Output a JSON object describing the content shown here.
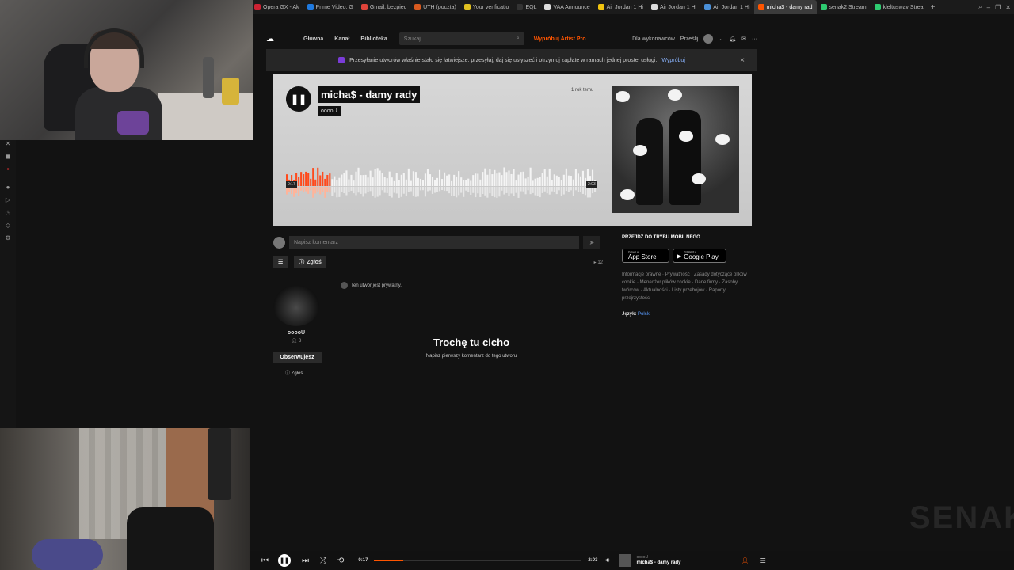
{
  "browser": {
    "tabs": [
      {
        "label": "Opera GX - Ak",
        "color": "#cc2233"
      },
      {
        "label": "Prime Video: G",
        "color": "#1f7ae0"
      },
      {
        "label": "Gmail: bezpiec",
        "color": "#e0443a"
      },
      {
        "label": "UTH (poczta)",
        "color": "#d85a1f"
      },
      {
        "label": "Your verificatio",
        "color": "#e0c020"
      },
      {
        "label": "EQL",
        "color": "#333333"
      },
      {
        "label": "VAA Announce",
        "color": "#dddddd"
      },
      {
        "label": "Air Jordan 1 Hi",
        "color": "#f1c40f"
      },
      {
        "label": "Air Jordan 1 Hi",
        "color": "#dddddd"
      },
      {
        "label": "Air Jordan 1 Hi",
        "color": "#4a90d9"
      },
      {
        "label": "micha$ - damy rad",
        "color": "#ff5500",
        "active": true
      },
      {
        "label": "senak2 Stream",
        "color": "#2ecc71"
      },
      {
        "label": "kleltuswav Strea",
        "color": "#2ecc71"
      }
    ],
    "add_tab_icon": "plus-icon",
    "toolbar_icons": [
      "search-icon",
      "minimize-icon",
      "restore-icon",
      "close-icon"
    ]
  },
  "sc_header": {
    "nav": [
      "Główna",
      "Kanał",
      "Biblioteka"
    ],
    "search_placeholder": "Szukaj",
    "pro_link": "Wypróbuj Artist Pro",
    "for_artists": "Dla wykonawców",
    "upload": "Prześlij"
  },
  "banner": {
    "text": "Przesyłanie utworów właśnie stało się łatwiejsze: przesyłaj, daj się usłyszeć i otrzymuj zapłatę w ramach jednej prostej usługi.",
    "link": "Wypróbuj",
    "close": "×"
  },
  "track": {
    "title": "micha$ - damy rady",
    "artist": "ooooU",
    "age": "1 rok temu",
    "time_start": "0:17",
    "time_end": "2:03",
    "progress": 0.14
  },
  "comment": {
    "placeholder": "Napisz komentarz",
    "report_label": "Zgłoś",
    "plays": "12"
  },
  "artist": {
    "name": "ooooU",
    "followers": "3",
    "follow_label": "Obserwujesz",
    "report_label": "Zgłoś"
  },
  "private_note": "Ten utwór jest prywatny.",
  "empty_comments": {
    "title": "Trochę tu cicho",
    "subtitle": "Napisz pierwszy komentarz do tego utworu"
  },
  "sidebar": {
    "mobile_heading": "PRZEJDŹ DO TRYBU MOBILNEGO",
    "app_store_small": "Pobierz w",
    "app_store": "App Store",
    "google_small": "POBIERZ Z",
    "google_play": "Google Play",
    "links": "Informacje prawne · Prywatność · Zasady dotyczące plików cookie · Menedżer plików cookie · Dane firmy · Zasoby twórców · Aktualności · Listy przebojów · Raporty przejrzystości",
    "language_label": "Język:",
    "language_value": "Polski"
  },
  "watermark": "SENAK",
  "player": {
    "time_current": "0:17",
    "time_total": "2:03",
    "progress": 0.14,
    "artist": "ooooU",
    "title": "micha$ - damy rady"
  }
}
